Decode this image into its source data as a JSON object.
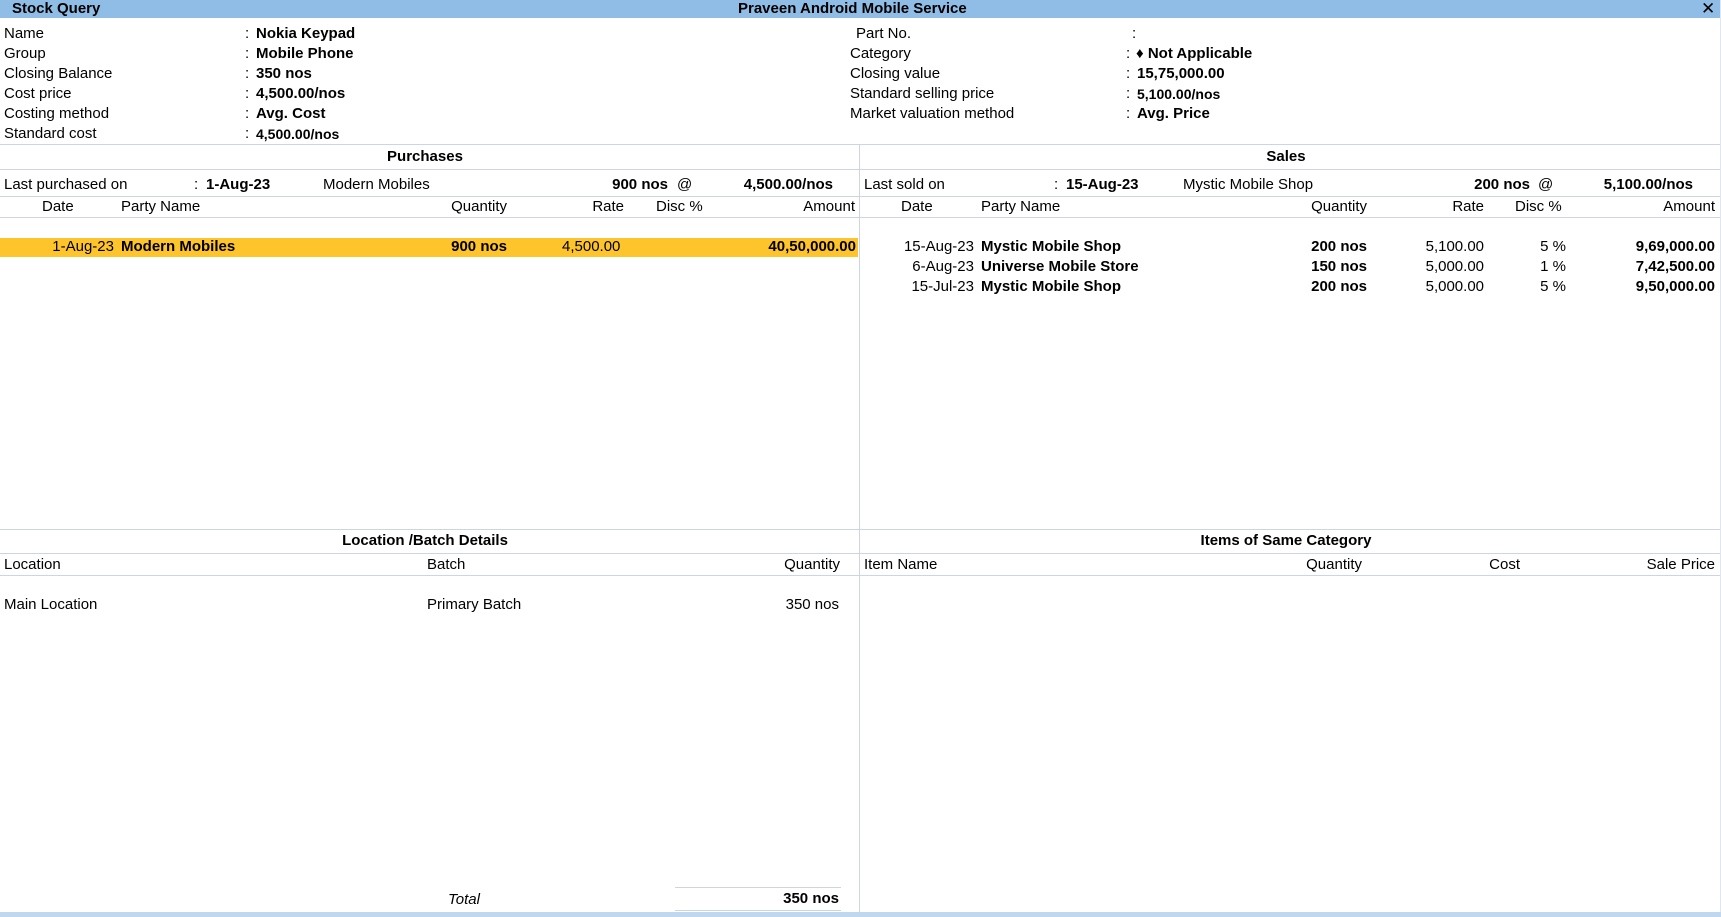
{
  "window": {
    "title": "Stock Query",
    "company": "Praveen Android Mobile Service",
    "close_symbol": "✕"
  },
  "details": {
    "left": [
      {
        "label": "Name",
        "value": "Nokia Keypad"
      },
      {
        "label": "Group",
        "value": "Mobile Phone"
      },
      {
        "label": "Closing Balance",
        "value": "350 nos"
      },
      {
        "label": "Cost price",
        "value": "4,500.00/nos"
      },
      {
        "label": "Costing method",
        "value": "Avg. Cost"
      },
      {
        "label": "Standard cost",
        "value": "4,500.00/nos"
      }
    ],
    "right": [
      {
        "label": "Part No.",
        "value": ""
      },
      {
        "label": "Category",
        "value": "♦ Not Applicable"
      },
      {
        "label": "Closing value",
        "value": "15,75,000.00"
      },
      {
        "label": "Standard selling price",
        "value": "5,100.00/nos"
      },
      {
        "label": "Market valuation method",
        "value": "Avg. Price"
      }
    ]
  },
  "purchases": {
    "title": "Purchases",
    "last_label": "Last purchased on",
    "last_date": "1-Aug-23",
    "last_party": "Modern Mobiles",
    "last_qty": "900 nos",
    "at": "@",
    "last_rate": "4,500.00/nos",
    "headers": {
      "date": "Date",
      "party": "Party Name",
      "quantity": "Quantity",
      "rate": "Rate",
      "disc": "Disc %",
      "amount": "Amount"
    },
    "rows": [
      {
        "date": "1-Aug-23",
        "party": "Modern Mobiles",
        "quantity": "900 nos",
        "rate": "4,500.00",
        "disc": "",
        "amount": "40,50,000.00"
      }
    ]
  },
  "sales": {
    "title": "Sales",
    "last_label": "Last sold on",
    "last_date": "15-Aug-23",
    "last_party": "Mystic Mobile Shop",
    "last_qty": "200 nos",
    "at": "@",
    "last_rate": "5,100.00/nos",
    "headers": {
      "date": "Date",
      "party": "Party Name",
      "quantity": "Quantity",
      "rate": "Rate",
      "disc": "Disc %",
      "amount": "Amount"
    },
    "rows": [
      {
        "date": "15-Aug-23",
        "party": "Mystic Mobile Shop",
        "quantity": "200 nos",
        "rate": "5,100.00",
        "disc": "5 %",
        "amount": "9,69,000.00"
      },
      {
        "date": "6-Aug-23",
        "party": "Universe Mobile Store",
        "quantity": "150 nos",
        "rate": "5,000.00",
        "disc": "1 %",
        "amount": "7,42,500.00"
      },
      {
        "date": "15-Jul-23",
        "party": "Mystic Mobile Shop",
        "quantity": "200 nos",
        "rate": "5,000.00",
        "disc": "5 %",
        "amount": "9,50,000.00"
      }
    ]
  },
  "location": {
    "title": "Location /Batch Details",
    "headers": {
      "location": "Location",
      "batch": "Batch",
      "quantity": "Quantity"
    },
    "rows": [
      {
        "location": "Main Location",
        "batch": "Primary Batch",
        "quantity": "350 nos"
      }
    ],
    "total_label": "Total",
    "total_value": "350 nos"
  },
  "same_category": {
    "title": "Items of Same Category",
    "headers": {
      "item": "Item Name",
      "quantity": "Quantity",
      "cost": "Cost",
      "sale_price": "Sale Price"
    }
  },
  "colors": {
    "titlebar": "#8fbde6",
    "highlight": "#fdc42b"
  }
}
